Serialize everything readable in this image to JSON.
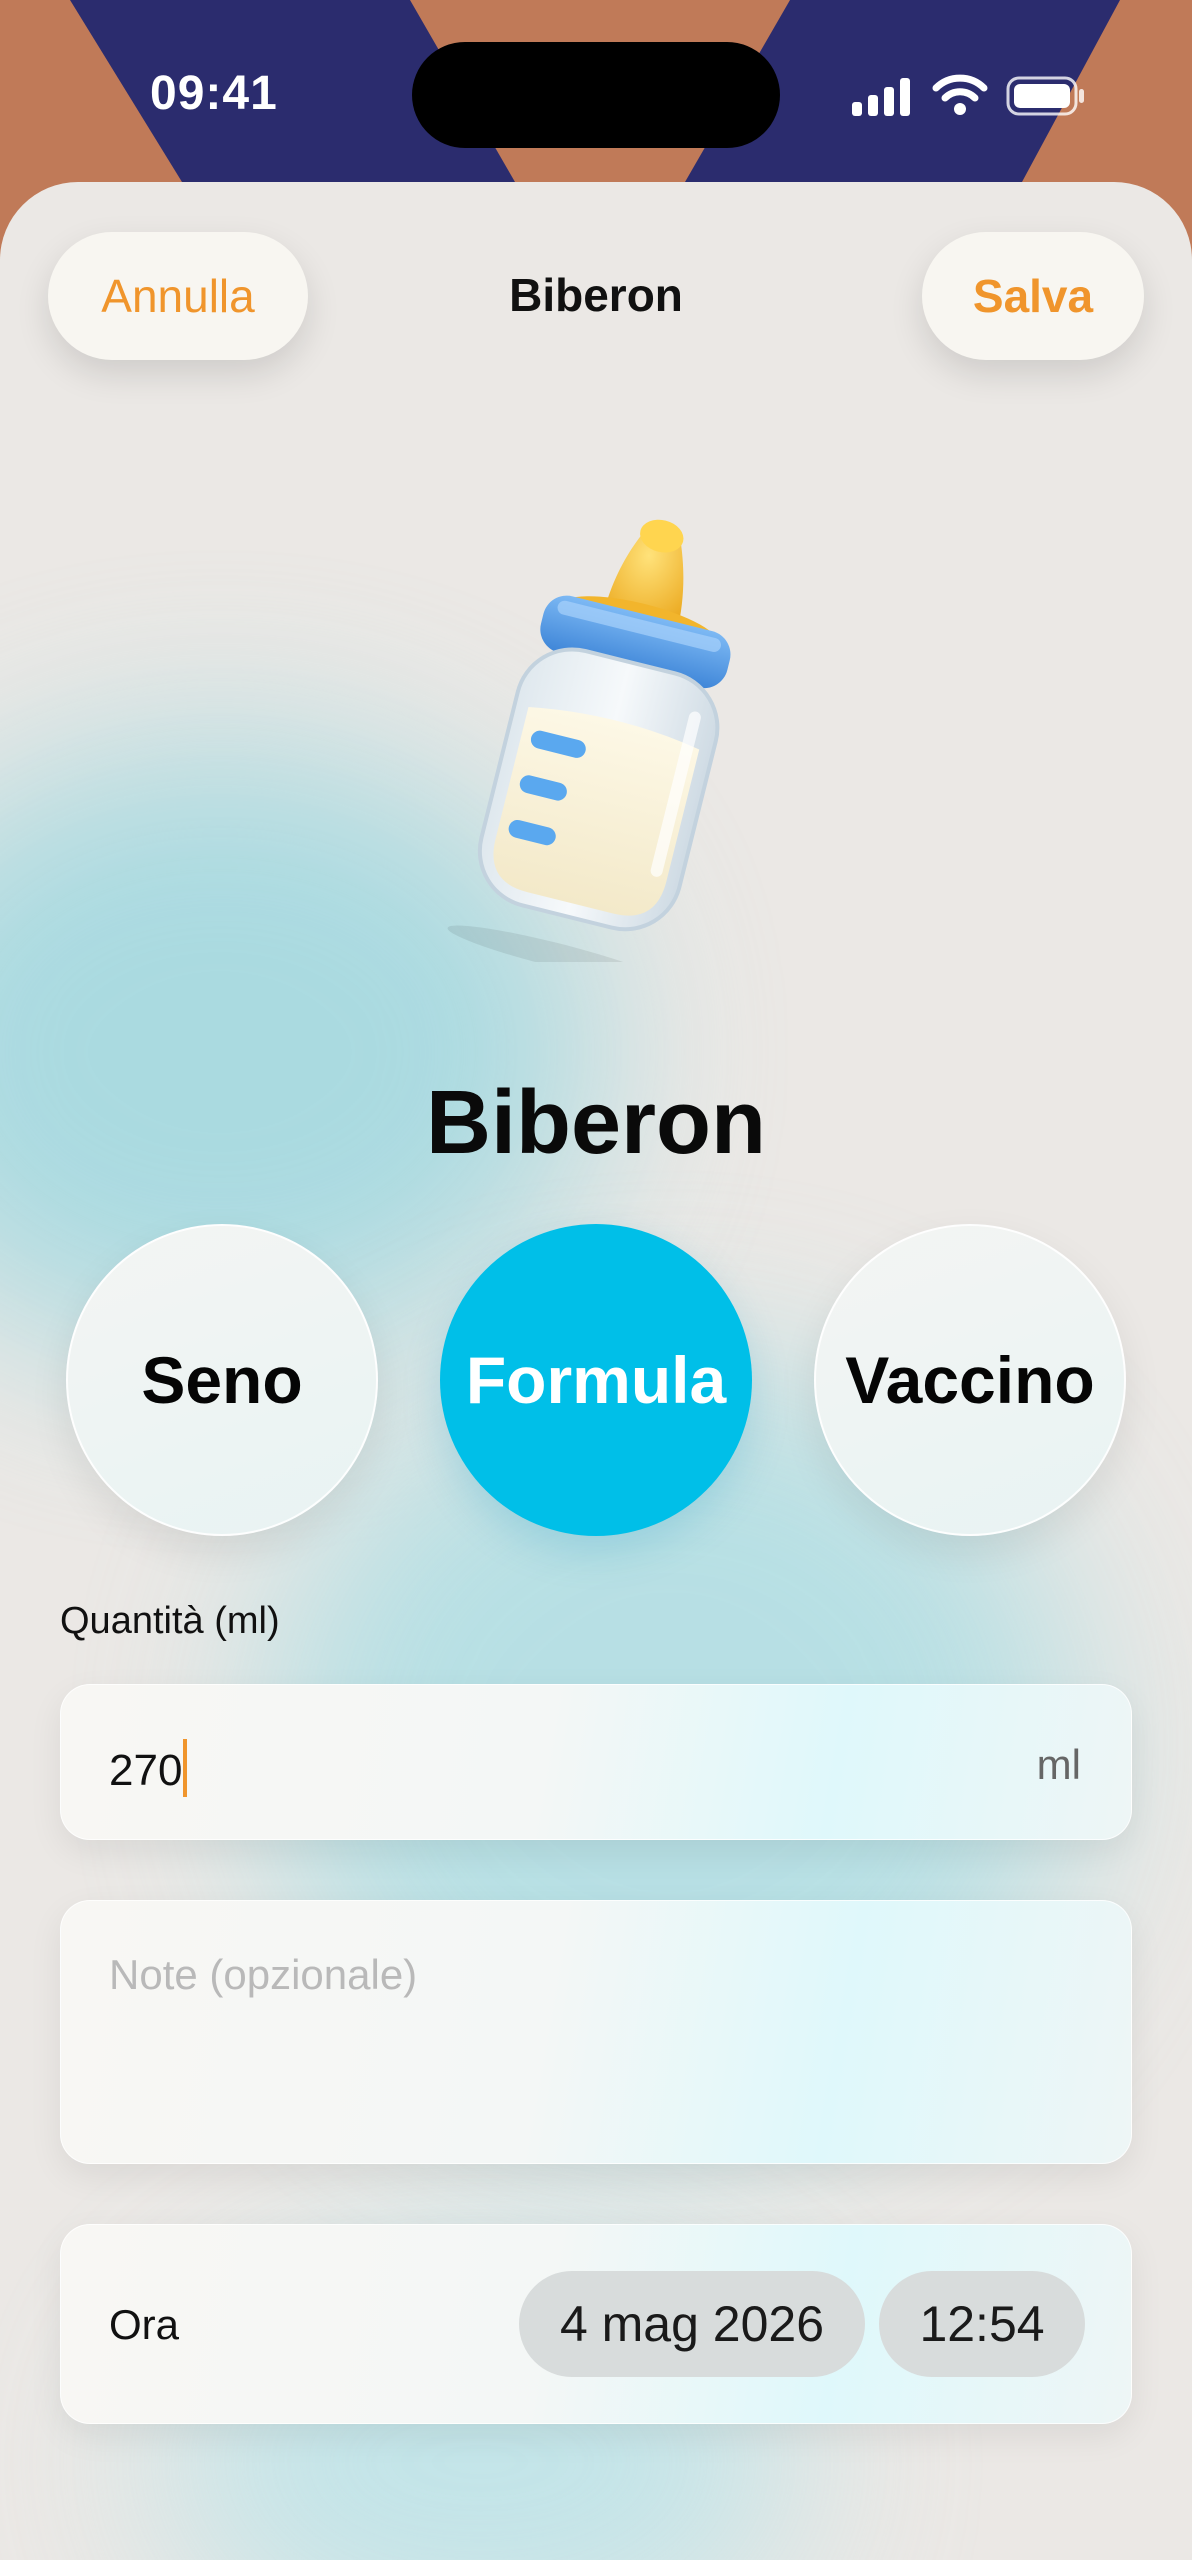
{
  "status_bar": {
    "time": "09:41",
    "icons": [
      "signal-bars-icon",
      "wifi-icon",
      "battery-icon"
    ]
  },
  "nav": {
    "cancel_label": "Annulla",
    "title": "Biberon",
    "save_label": "Salva"
  },
  "illustration": {
    "icon": "baby-bottle-icon"
  },
  "heading": "Biberon",
  "feeding_types": [
    {
      "label": "Seno",
      "selected": false
    },
    {
      "label": "Formula",
      "selected": true
    },
    {
      "label": "Vaccino",
      "selected": false
    }
  ],
  "quantity": {
    "label": "Quantità (ml)",
    "value": "270",
    "unit": "ml"
  },
  "notes": {
    "placeholder": "Note (opzionale)",
    "value": ""
  },
  "time_row": {
    "label": "Ora",
    "date": "4 mag 2026",
    "time": "12:54"
  },
  "colors": {
    "accent_orange": "#f0952c",
    "selected_blue": "#00bfe8",
    "sheet_background": "#ebe8e5",
    "wallpaper_orange": "#c07a58",
    "wallpaper_navy": "#2b2c6e"
  }
}
